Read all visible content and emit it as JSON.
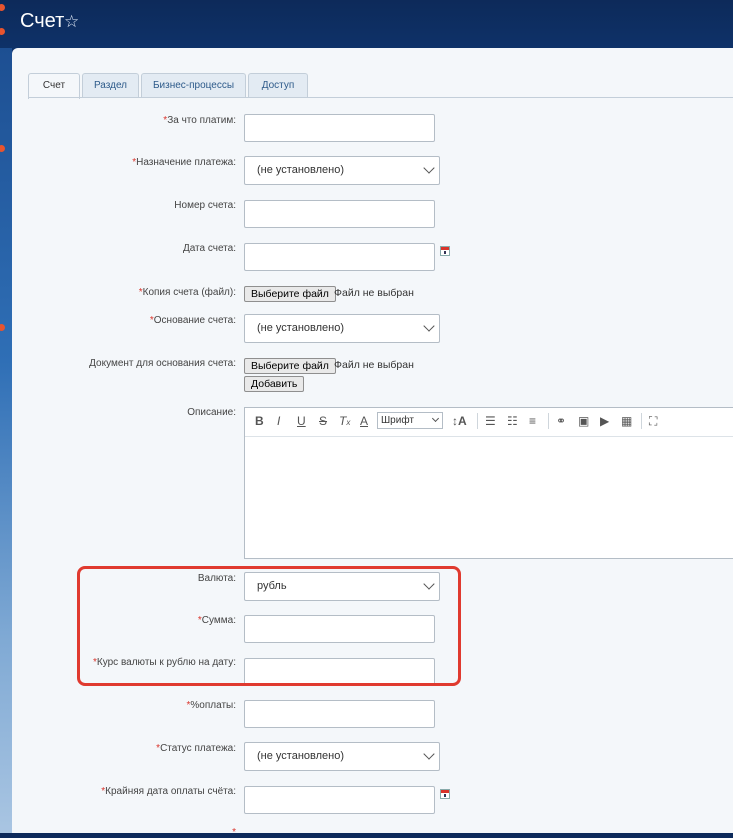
{
  "header": {
    "title": "Счет"
  },
  "tabs": [
    {
      "label": "Счет"
    },
    {
      "label": "Раздел"
    },
    {
      "label": "Бизнес-процессы"
    },
    {
      "label": "Доступ"
    }
  ],
  "fields": {
    "pay_for": {
      "label": "За что платим:",
      "required": true,
      "value": ""
    },
    "purpose": {
      "label": "Назначение платежа:",
      "required": true,
      "value": "(не установлено)"
    },
    "invoice_number": {
      "label": "Номер счета:",
      "required": false,
      "value": ""
    },
    "invoice_date": {
      "label": "Дата счета:",
      "required": false,
      "value": ""
    },
    "invoice_copy": {
      "label": "Копия счета (файл):",
      "required": true,
      "button": "Выберите файл",
      "status": "Файл не выбран"
    },
    "basis": {
      "label": "Основание счета:",
      "required": true,
      "value": "(не установлено)"
    },
    "basis_doc": {
      "label": "Документ для основания счета:",
      "required": false,
      "button": "Выберите файл",
      "status": "Файл не выбран",
      "add_button": "Добавить"
    },
    "description": {
      "label": "Описание:",
      "required": false,
      "font_select": "Шрифт"
    },
    "currency": {
      "label": "Валюта:",
      "required": false,
      "value": "рубль"
    },
    "amount": {
      "label": "Сумма:",
      "required": true,
      "value": ""
    },
    "rate": {
      "label": "Курс валюты к рублю на дату:",
      "required": true,
      "value": ""
    },
    "paid_percent": {
      "label": "%оплаты:",
      "required": true,
      "value": ""
    },
    "payment_status": {
      "label": "Статус платежа:",
      "required": true,
      "value": "(не установлено)"
    },
    "due_date": {
      "label": "Крайняя дата оплаты счёта:",
      "required": true,
      "value": ""
    }
  },
  "colors": {
    "required_mark": "#d9342b",
    "highlight_frame": "#e03a2f"
  }
}
